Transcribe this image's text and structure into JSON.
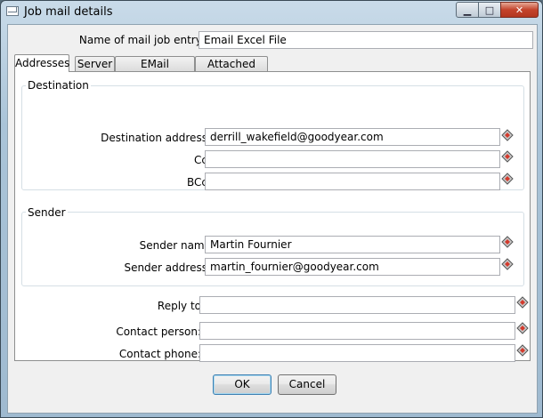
{
  "window": {
    "title": "Job mail details",
    "min_glyph": "▁",
    "max_glyph": "□",
    "close_glyph": "✕"
  },
  "job": {
    "label": "Name of mail job entry:",
    "value": "Email Excel File"
  },
  "tabs": [
    {
      "label": "Addresses",
      "active": true
    },
    {
      "label": "Server",
      "active": false
    },
    {
      "label": "EMail Message",
      "active": false
    },
    {
      "label": "Attached Files",
      "active": false
    }
  ],
  "destination": {
    "title": "Destination",
    "address_label": "Destination address:",
    "address_value": "derrill_wakefield@goodyear.com",
    "cc_label": "Cc:",
    "cc_value": "",
    "bcc_label": "BCc:",
    "bcc_value": ""
  },
  "sender": {
    "title": "Sender",
    "name_label": "Sender name",
    "name_value": "Martin Fournier",
    "address_label": "Sender address:",
    "address_value": "martin_fournier@goodyear.com"
  },
  "extra": {
    "reply_label": "Reply to",
    "reply_value": "",
    "contact_person_label": "Contact person:",
    "contact_person_value": "",
    "contact_phone_label": "Contact phone:",
    "contact_phone_value": ""
  },
  "buttons": {
    "ok_label": "OK",
    "cancel_label": "Cancel"
  },
  "icons": {
    "variable": "variable-diamond-icon",
    "accent": "#d33a2c"
  }
}
